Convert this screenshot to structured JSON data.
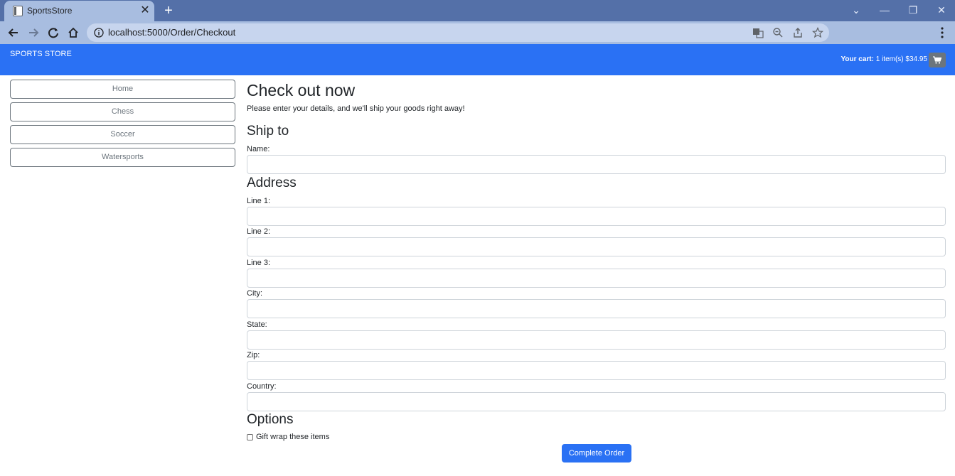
{
  "browser": {
    "tab_title": "SportsStore",
    "url": "localhost:5000/Order/Checkout"
  },
  "header": {
    "brand": "SPORTS STORE",
    "cart_label": "Your cart:",
    "cart_summary": "1 item(s) $34.95"
  },
  "sidebar": {
    "categories": [
      {
        "label": "Home"
      },
      {
        "label": "Chess"
      },
      {
        "label": "Soccer"
      },
      {
        "label": "Watersports"
      }
    ]
  },
  "checkout": {
    "title": "Check out now",
    "intro": "Please enter your details, and we'll ship your goods right away!",
    "ship_to_heading": "Ship to",
    "name_label": "Name:",
    "address_heading": "Address",
    "line1_label": "Line 1:",
    "line2_label": "Line 2:",
    "line3_label": "Line 3:",
    "city_label": "City:",
    "state_label": "State:",
    "zip_label": "Zip:",
    "country_label": "Country:",
    "options_heading": "Options",
    "gift_wrap_label": "Gift wrap these items",
    "gift_wrap_checked": false,
    "submit_label": "Complete Order"
  },
  "colors": {
    "header_bg": "#2a71f4",
    "button_primary": "#2a71f4",
    "outline_secondary": "#6c757d",
    "tabstrip": "#5470a8",
    "toolbar": "#a8bde0"
  }
}
